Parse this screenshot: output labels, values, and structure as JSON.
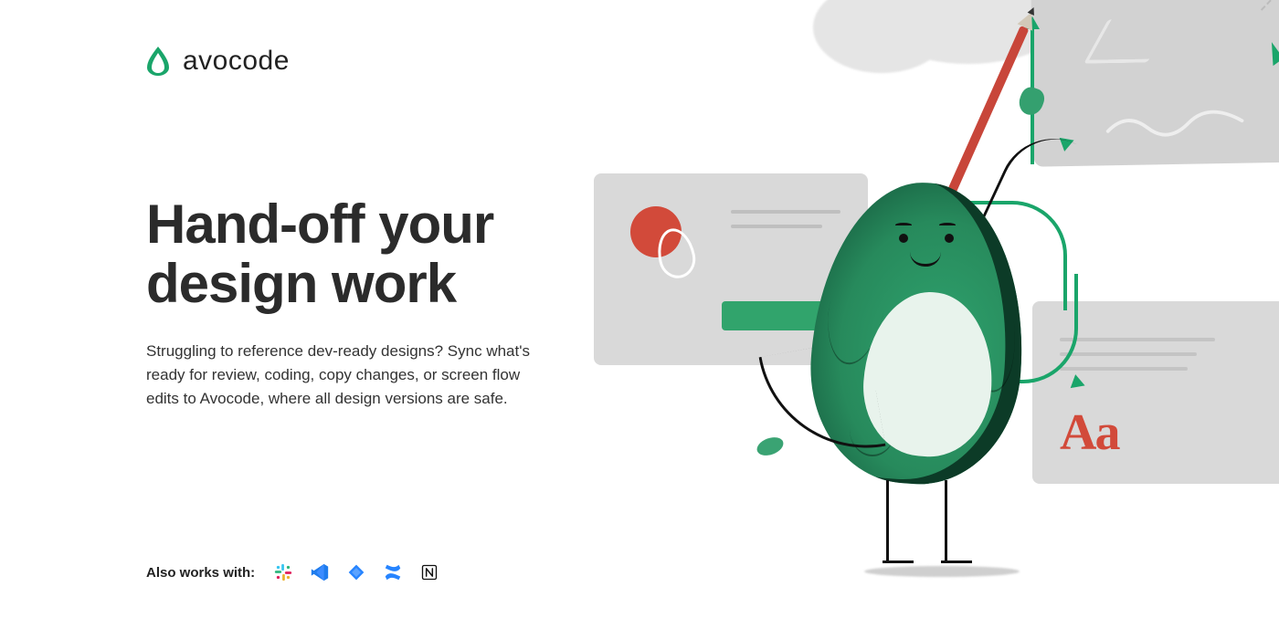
{
  "brand": {
    "name": "avocode",
    "accent": "#1aa56a"
  },
  "hero": {
    "headline_line1": "Hand-off your",
    "headline_line2": "design work",
    "subtext": "Struggling to reference dev-ready designs? Sync what's ready for review, coding, copy changes, or screen flow edits to Avocode, where all design versions are safe."
  },
  "integrations": {
    "label": "Also works with:",
    "apps": [
      "slack",
      "vscode",
      "jira",
      "confluence",
      "notion"
    ]
  },
  "illustration": {
    "typography_sample": "Aa",
    "accent_red": "#d24a3a",
    "card_bg": "#d9d9d9"
  }
}
